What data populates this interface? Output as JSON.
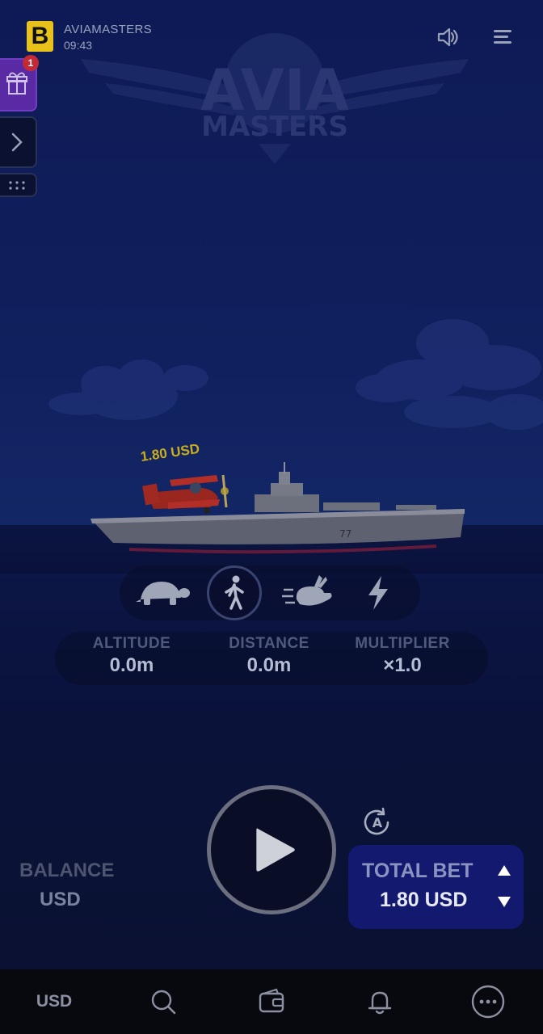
{
  "header": {
    "brand_letter": "B",
    "app_title": "AVIAMASTERS",
    "time": "09:43"
  },
  "logo": {
    "line1": "AVIA",
    "line2": "MASTERS"
  },
  "side_panel": {
    "gift_badge_count": "1"
  },
  "scene": {
    "plane_bet_label": "1.80 USD"
  },
  "speed_selector": {
    "options": [
      "turtle-icon",
      "walking-person-icon",
      "rabbit-icon",
      "lightning-icon"
    ],
    "selected": "walking-person-icon"
  },
  "stats": [
    {
      "label": "ALTITUDE",
      "value": "0.0m"
    },
    {
      "label": "DISTANCE",
      "value": "0.0m"
    },
    {
      "label": "MULTIPLIER",
      "value": "×1.0"
    }
  ],
  "balance": {
    "label": "BALANCE",
    "currency": "USD"
  },
  "bet": {
    "label": "TOTAL BET",
    "value": "1.80 USD"
  },
  "bottom_nav": {
    "currency_label": "USD",
    "icons": [
      "search-icon",
      "wallet-icon",
      "bell-icon",
      "more-icon"
    ]
  },
  "colors": {
    "accent_yellow": "#e8c21a",
    "bet_panel": "#13196e",
    "gift_purple": "#5a2aa4",
    "badge_red": "#c32a35"
  }
}
